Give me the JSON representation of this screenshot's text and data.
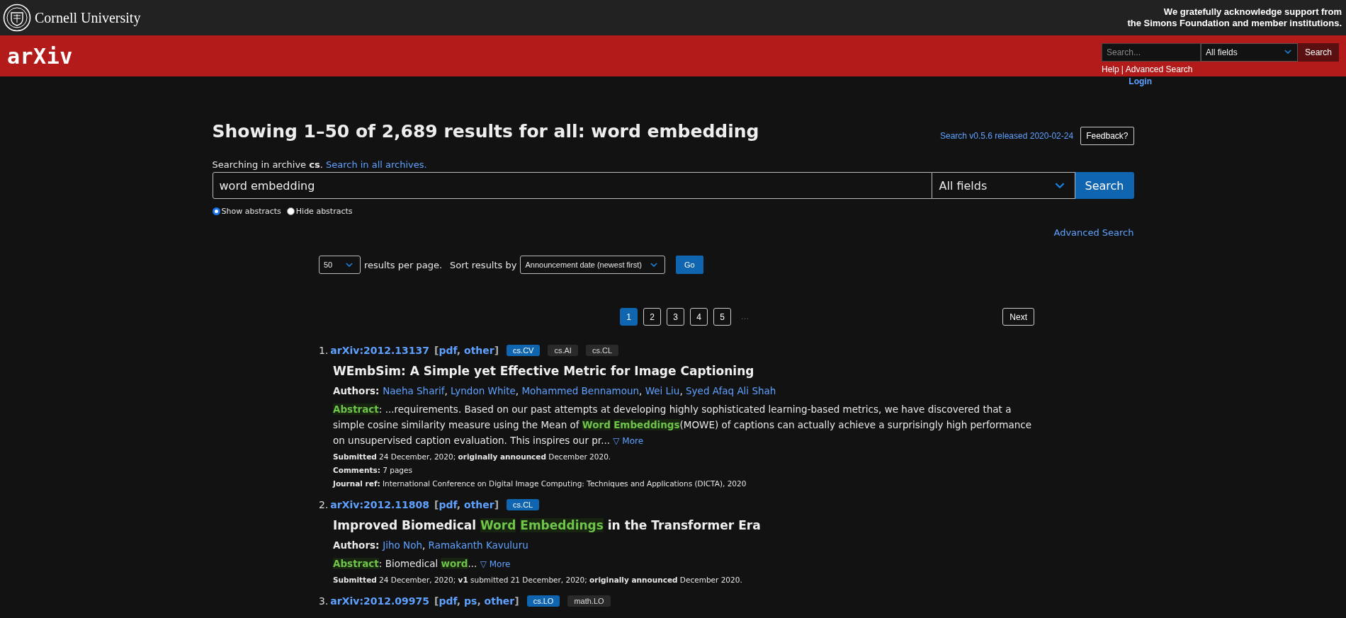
{
  "header": {
    "university": "Cornell University",
    "support": [
      "We gratefully acknowledge support from",
      "the Simons Foundation and member institutions."
    ]
  },
  "brand": {
    "logo": "arXiv",
    "search": {
      "placeholder": "Search...",
      "field": "All fields",
      "button": "Search"
    },
    "links": [
      "Help",
      "Advanced Search"
    ],
    "separator": "|",
    "login": "Login"
  },
  "main": {
    "heading": "Showing 1–50 of 2,689 results for all: word embedding",
    "version": "Search v0.5.6 released 2020-02-24",
    "feedback": "Feedback?",
    "archive_text": "Searching in archive **cs**.",
    "archive_link": "Search in all archives.",
    "query": "word embedding",
    "field": "All fields",
    "search_button": "Search",
    "radios": [
      {
        "label": "Show abstracts",
        "selected": true
      },
      {
        "label": "Hide abstracts",
        "selected": false
      }
    ],
    "advanced": "Advanced Search",
    "per_page": "50",
    "per_page_text": "results per page.",
    "sort_label": "Sort results by",
    "sort": "Announcement date (newest first)",
    "go": "Go",
    "pages": [
      {
        "label": "1",
        "selected": true
      },
      {
        "label": "2",
        "selected": false
      },
      {
        "label": "3",
        "selected": false
      },
      {
        "label": "4",
        "selected": false
      },
      {
        "label": "5",
        "selected": false
      }
    ],
    "ellipsis": "…",
    "next": "Next"
  },
  "punctuation": {
    "open": "[",
    "close": "]",
    "comma": ","
  },
  "results": [
    {
      "number": "1.",
      "id": "arXiv:2012.13137",
      "formats": [
        "pdf",
        "other"
      ],
      "tags": [
        {
          "label": "cs.CV",
          "primary": true
        },
        {
          "label": "cs.AI",
          "primary": false
        },
        {
          "label": "cs.CL",
          "primary": false
        }
      ],
      "title": [
        {
          "text": "WEmbSim: A Simple yet Effective Metric for Image Captioning",
          "highlight": false
        }
      ],
      "authors_label": "Authors:",
      "authors": [
        "Naeha Sharif",
        "Lyndon White",
        "Mohammed Bennamoun",
        "Wei Liu",
        "Syed Afaq Ali Shah"
      ],
      "abstract": [
        {
          "text": "Abstract",
          "highlight": true
        },
        {
          "text": ": ...requirements. Based on our past attempts at developing highly sophisticated learning-based metrics, we have discovered that a simple cosine similarity measure using the Mean of ",
          "highlight": false
        },
        {
          "text": "Word Embeddings",
          "highlight": true
        },
        {
          "text": "(MOWE) of captions can actually achieve a surprisingly high performance on unsupervised caption evaluation. This inspires our pr... ",
          "highlight": false
        }
      ],
      "more": "▽ More",
      "meta": [
        "**Submitted** 24 December, 2020; **originally announced** December 2020.",
        "**Comments:** 7 pages",
        "**Journal ref:** International Conference on Digital Image Computing: Techniques and Applications (DICTA), 2020"
      ]
    },
    {
      "number": "2.",
      "id": "arXiv:2012.11808",
      "formats": [
        "pdf",
        "other"
      ],
      "tags": [
        {
          "label": "cs.CL",
          "primary": true
        }
      ],
      "title": [
        {
          "text": "Improved Biomedical ",
          "highlight": false
        },
        {
          "text": "Word Embeddings",
          "highlight": true
        },
        {
          "text": " in the Transformer Era",
          "highlight": false
        }
      ],
      "authors_label": "Authors:",
      "authors": [
        "Jiho Noh",
        "Ramakanth Kavuluru"
      ],
      "abstract": [
        {
          "text": "Abstract",
          "highlight": true
        },
        {
          "text": ": Biomedical ",
          "highlight": false
        },
        {
          "text": "word",
          "highlight": true
        },
        {
          "text": "... ",
          "highlight": false
        }
      ],
      "more": "▽ More",
      "meta": [
        "**Submitted** 24 December, 2020; **v1** submitted 21 December, 2020; **originally announced** December 2020."
      ]
    },
    {
      "number": "3.",
      "id": "arXiv:2012.09975",
      "formats": [
        "pdf",
        "ps",
        "other"
      ],
      "tags": [
        {
          "label": "cs.LO",
          "primary": true
        },
        {
          "label": "math.LO",
          "primary": false
        }
      ]
    }
  ]
}
